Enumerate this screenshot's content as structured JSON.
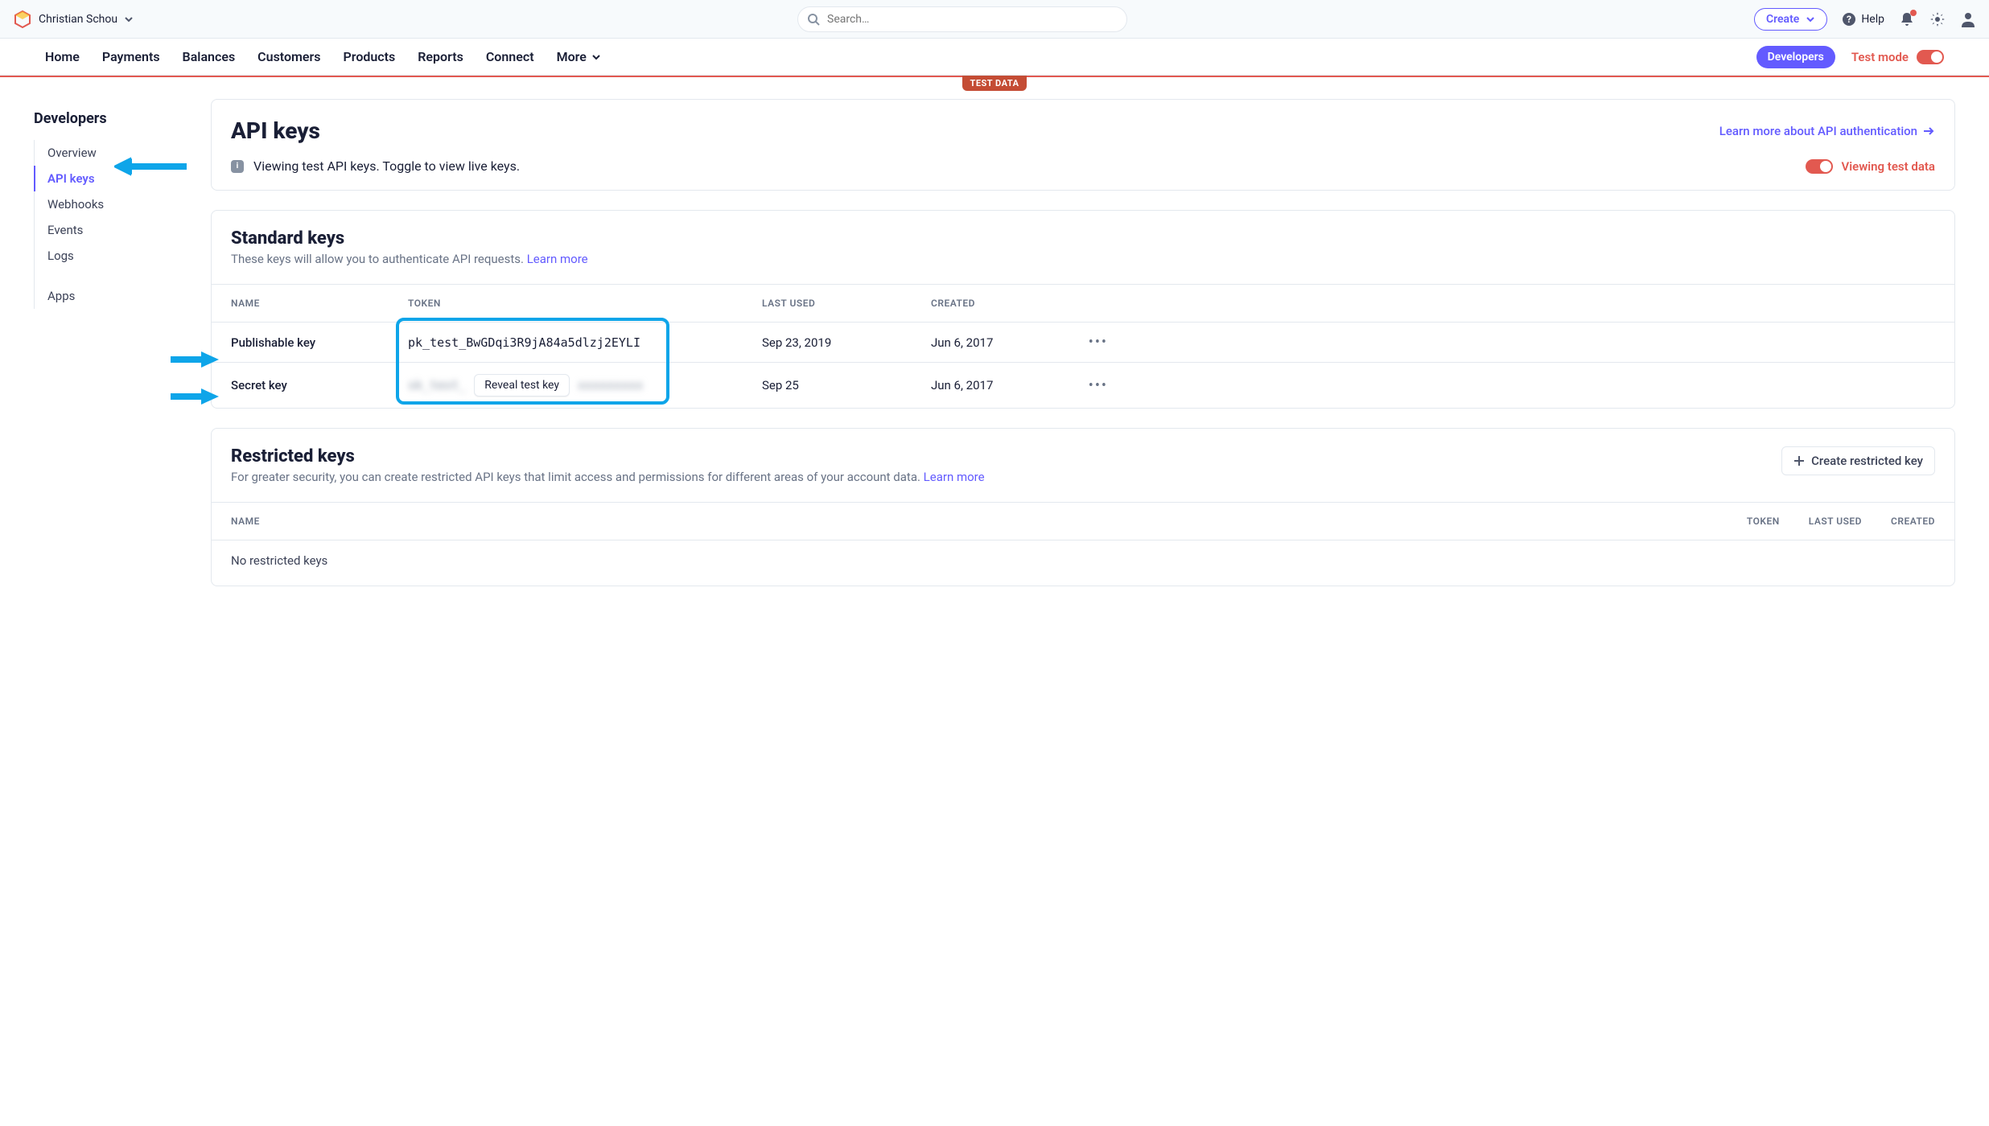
{
  "topbar": {
    "account_name": "Christian Schou",
    "search_placeholder": "Search…",
    "create_label": "Create",
    "help_label": "Help"
  },
  "mainnav": {
    "items": [
      "Home",
      "Payments",
      "Balances",
      "Customers",
      "Products",
      "Reports",
      "Connect",
      "More"
    ],
    "developers_label": "Developers",
    "test_mode_label": "Test mode"
  },
  "testdata_badge": "TEST DATA",
  "sidebar": {
    "title": "Developers",
    "items": [
      "Overview",
      "API keys",
      "Webhooks",
      "Events",
      "Logs"
    ],
    "extra": [
      "Apps"
    ],
    "active_index": 1
  },
  "header_card": {
    "title": "API keys",
    "learn_link": "Learn more about API authentication",
    "info_text": "Viewing test API keys. Toggle to view live keys.",
    "viewing_label": "Viewing test data"
  },
  "standard_keys": {
    "title": "Standard keys",
    "subtitle": "These keys will allow you to authenticate API requests. ",
    "learn_more": "Learn more",
    "columns": [
      "NAME",
      "TOKEN",
      "LAST USED",
      "CREATED"
    ],
    "rows": [
      {
        "name": "Publishable key",
        "token": "pk_test_BwGDqi3R9jA84a5dlzj2EYLI",
        "last_used": "Sep 23, 2019",
        "created": "Jun 6, 2017"
      },
      {
        "name": "Secret key",
        "token_hidden_left": "sk_test_",
        "token_hidden_right": "xxxxxxxxx",
        "reveal_label": "Reveal test key",
        "last_used": "Sep 25",
        "created": "Jun 6, 2017"
      }
    ]
  },
  "restricted_keys": {
    "title": "Restricted keys",
    "subtitle_1": "For greater security, you can create restricted API keys that limit access and permissions for different areas of your account data. ",
    "learn_more": "Learn more",
    "create_label": "Create restricted key",
    "columns": [
      "NAME",
      "TOKEN",
      "LAST USED",
      "CREATED"
    ],
    "empty": "No restricted keys"
  }
}
